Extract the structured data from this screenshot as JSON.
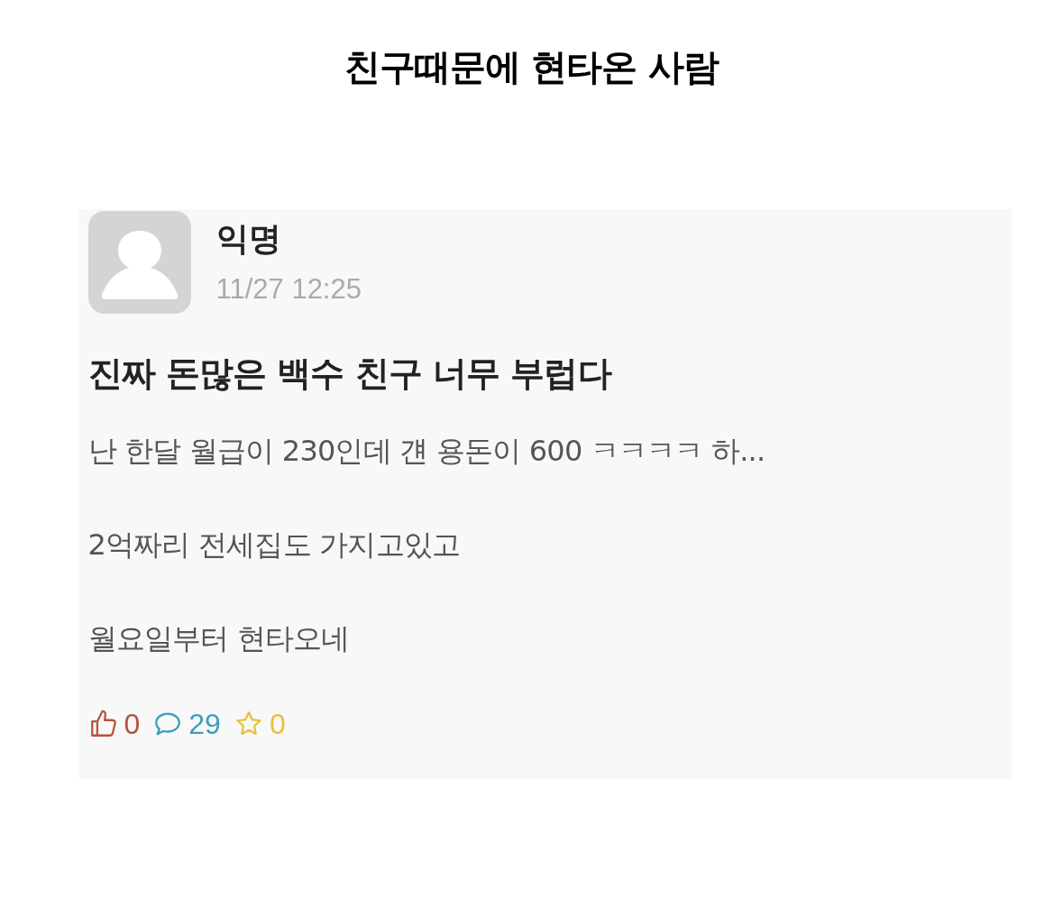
{
  "heading": "친구때문에 현타온 사람",
  "post": {
    "author": "익명",
    "time": "11/27 12:25",
    "title": "진짜 돈많은 백수 친구 너무 부럽다",
    "body": [
      "난 한달 월급이 230인데 걘 용돈이 600 ㅋㅋㅋㅋ 하...",
      "2억짜리 전세집도 가지고있고",
      "월요일부터 현타오네"
    ],
    "stats": [
      {
        "kind": "like",
        "count": "0",
        "color": "#b5533c"
      },
      {
        "kind": "comment",
        "count": "29",
        "color": "#3aa0b8"
      },
      {
        "kind": "scrap",
        "count": "0",
        "color": "#e6c23a"
      }
    ]
  }
}
